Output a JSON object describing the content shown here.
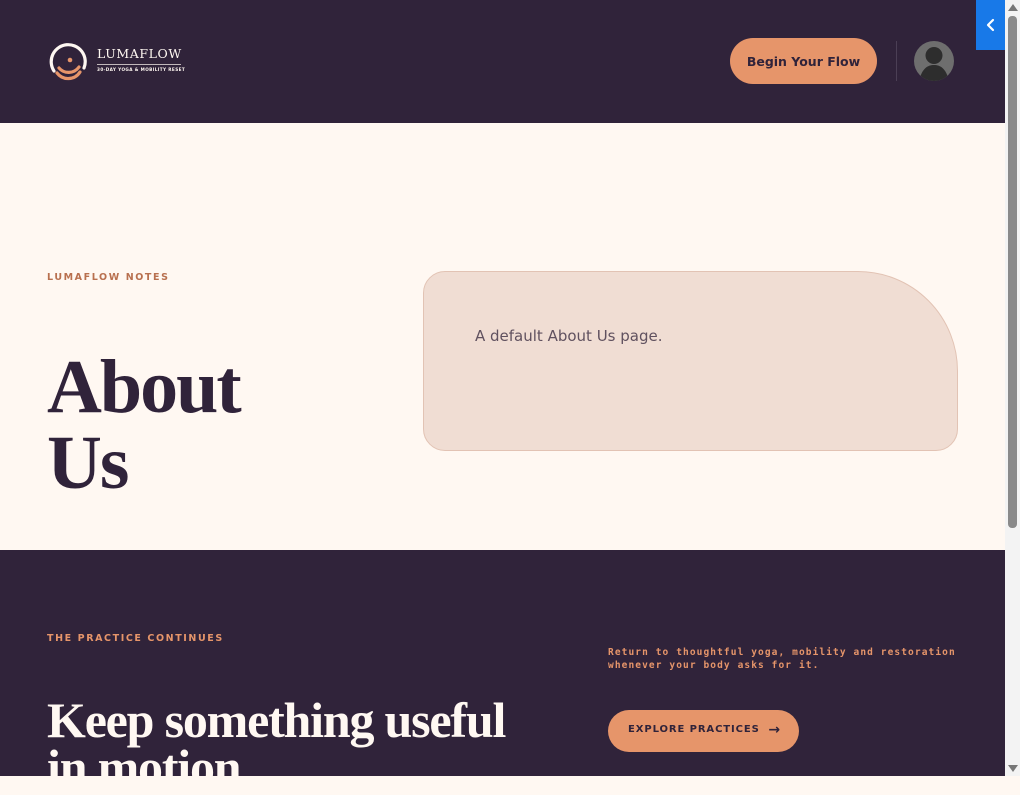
{
  "header": {
    "brand_name": "LUMAFLOW",
    "brand_tagline": "30-DAY YOGA & MOBILITY RESET",
    "cta_label": "Begin Your Flow",
    "avatar_icon": "user-avatar-icon"
  },
  "main": {
    "eyebrow": "LUMAFLOW NOTES",
    "title_line1": "About",
    "title_line2": "Us",
    "content": "A default About Us page."
  },
  "footer": {
    "eyebrow": "THE PRACTICE CONTINUES",
    "heading_line1": "Keep something useful",
    "heading_line2": "in motion.",
    "note": "Return to thoughtful yoga, mobility and restoration whenever your body asks for it.",
    "cta_label": "EXPLORE PRACTICES",
    "cta_arrow": "→"
  },
  "side_toggle": {
    "icon": "chevron-left-icon"
  },
  "colors": {
    "plum": "#30233a",
    "cream": "#fff8f2",
    "peach": "#e6956a",
    "card": "#f0ddd3",
    "toggle_blue": "#1879e8"
  }
}
